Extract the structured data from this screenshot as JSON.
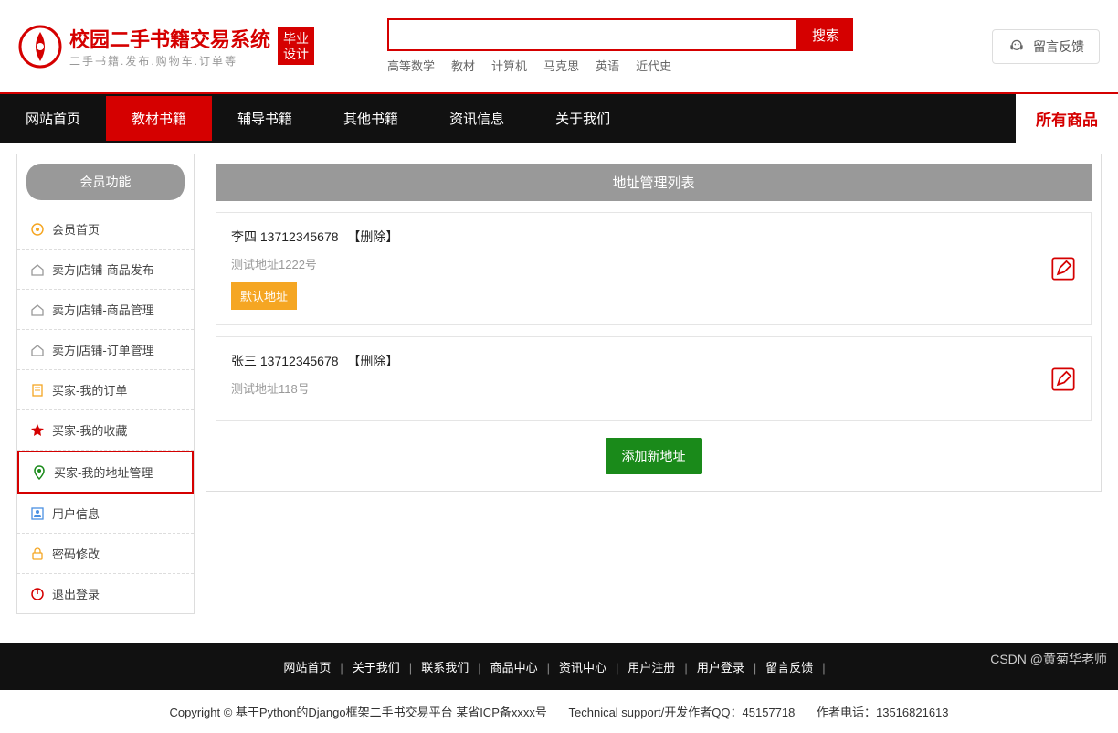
{
  "header": {
    "logo_title": "校园二手书籍交易系统",
    "logo_sub": "二手书籍.发布.购物车.订单等",
    "logo_badge_l1": "毕业",
    "logo_badge_l2": "设计",
    "search_placeholder": "",
    "search_btn": "搜索",
    "search_tags": [
      "高等数学",
      "教材",
      "计算机",
      "马克思",
      "英语",
      "近代史"
    ],
    "feedback": "留言反馈"
  },
  "nav": {
    "items": [
      "网站首页",
      "教材书籍",
      "辅导书籍",
      "其他书籍",
      "资讯信息",
      "关于我们"
    ],
    "active_index": 1,
    "all_products": "所有商品"
  },
  "sidebar": {
    "header": "会员功能",
    "items": [
      {
        "label": "会员首页",
        "icon": "home-gear",
        "color": "#f5a623"
      },
      {
        "label": "卖方|店铺-商品发布",
        "icon": "house",
        "color": "#999"
      },
      {
        "label": "卖方|店铺-商品管理",
        "icon": "house",
        "color": "#999"
      },
      {
        "label": "卖方|店铺-订单管理",
        "icon": "house",
        "color": "#999"
      },
      {
        "label": "买家-我的订单",
        "icon": "document",
        "color": "#f5a623"
      },
      {
        "label": "买家-我的收藏",
        "icon": "star",
        "color": "#d50000"
      },
      {
        "label": "买家-我的地址管理",
        "icon": "location",
        "color": "#1a8a1a",
        "highlighted": true
      },
      {
        "label": "用户信息",
        "icon": "user-doc",
        "color": "#4a90e2"
      },
      {
        "label": "密码修改",
        "icon": "lock",
        "color": "#f5a623"
      },
      {
        "label": "退出登录",
        "icon": "power",
        "color": "#d50000"
      }
    ]
  },
  "content": {
    "title": "地址管理列表",
    "addresses": [
      {
        "name": "李四",
        "phone": "13712345678",
        "delete": "【删除】",
        "detail": "测试地址1222号",
        "is_default": true
      },
      {
        "name": "张三",
        "phone": "13712345678",
        "delete": "【删除】",
        "detail": "测试地址118号",
        "is_default": false
      }
    ],
    "default_label": "默认地址",
    "add_btn": "添加新地址"
  },
  "footer": {
    "links": [
      "网站首页",
      "关于我们",
      "联系我们",
      "商品中心",
      "资讯中心",
      "用户注册",
      "用户登录",
      "留言反馈"
    ],
    "copyright": "Copyright © 基于Python的Django框架二手书交易平台 某省ICP备xxxx号",
    "tech": "Technical support/开发作者QQ：45157718",
    "phone": "作者电话：13516821613"
  },
  "watermark": "CSDN @黄菊华老师"
}
